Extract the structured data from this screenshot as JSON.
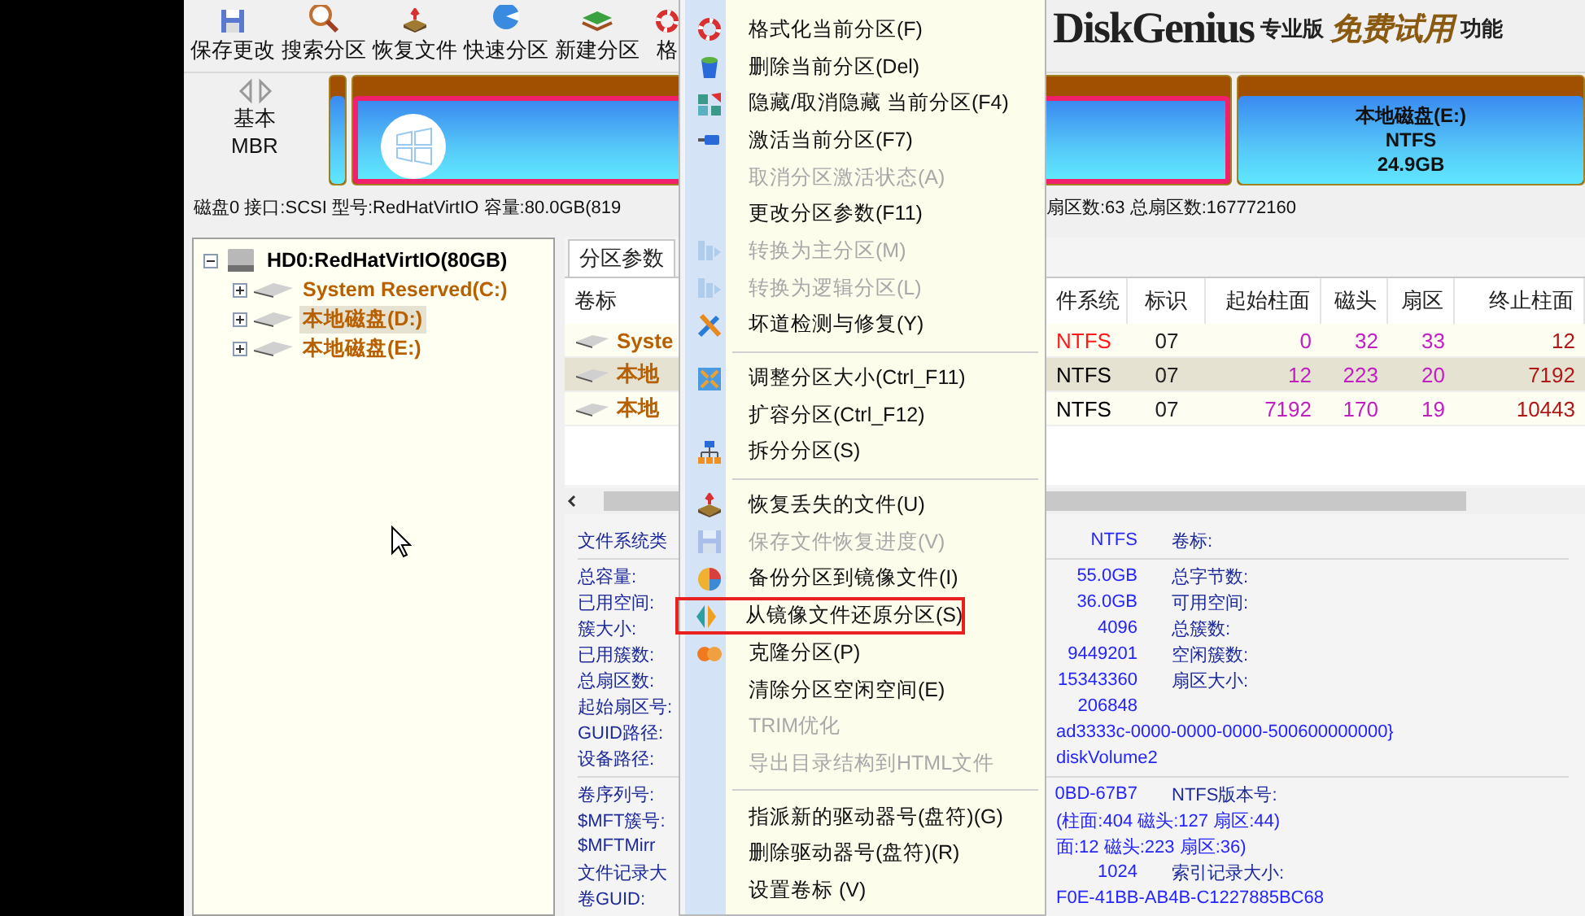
{
  "toolbar": {
    "buttons": [
      {
        "label": "保存更改"
      },
      {
        "label": "搜索分区"
      },
      {
        "label": "恢复文件"
      },
      {
        "label": "快速分区"
      },
      {
        "label": "新建分区"
      },
      {
        "label": "格"
      }
    ]
  },
  "logo": {
    "name": "DiskGenius",
    "edition": "专业版",
    "trial": "免费试用",
    "more": "功能"
  },
  "disk_map": {
    "type": "基本",
    "scheme": "MBR",
    "partitions": [
      {
        "kind": "plain",
        "selected": false
      },
      {
        "kind": "windows",
        "selected": true
      },
      {
        "kind": "labeled",
        "selected": false,
        "name": "本地磁盘(E:)",
        "fs": "NTFS",
        "size": "24.9GB"
      }
    ]
  },
  "disk_info": {
    "left": "磁盘0 接口:SCSI 型号:RedHatVirtIO 容量:80.0GB(819",
    "right": "扇区数:63 总扇区数:167772160"
  },
  "tree": {
    "label": "HD0:RedHatVirtIO(80GB)",
    "expanded": true,
    "children": [
      {
        "label": "System Reserved(C:)",
        "expanded": false,
        "selected": false
      },
      {
        "label": "本地磁盘(D:)",
        "expanded": false,
        "selected": true
      },
      {
        "label": "本地磁盘(E:)",
        "expanded": false,
        "selected": false
      }
    ]
  },
  "partition_panel": {
    "tabs": [
      {
        "label": "分区参数",
        "selected": true
      }
    ],
    "table": {
      "columns": [
        "卷标",
        "件系统",
        "标识",
        "起始柱面",
        "磁头",
        "扇区",
        "终止柱面"
      ],
      "rows": [
        {
          "selected": false,
          "color": "#ff1a1a",
          "cells": [
            "Syste",
            "NTFS",
            "07",
            "0",
            "32",
            "33",
            "12"
          ]
        },
        {
          "selected": true,
          "color": "#000000",
          "cells": [
            "本地",
            "NTFS",
            "07",
            "12",
            "223",
            "20",
            "7192"
          ]
        },
        {
          "selected": false,
          "color": "#000000",
          "cells": [
            "本地",
            "NTFS",
            "07",
            "7192",
            "170",
            "19",
            "10443"
          ]
        }
      ]
    },
    "details": [
      [
        {
          "kind": "pair",
          "label": "文件系统类",
          "value": "NTFS",
          "label2": "卷标:"
        }
      ],
      [
        {
          "kind": "pair",
          "label": "总容量:",
          "value": "55.0GB",
          "label2": "总字节数:"
        },
        {
          "kind": "pair",
          "label": "已用空间:",
          "value": "36.0GB",
          "label2": "可用空间:"
        },
        {
          "kind": "pair",
          "label": "簇大小:",
          "value": "4096",
          "label2": "总簇数:"
        },
        {
          "kind": "pair",
          "label": "已用簇数:",
          "value": "9449201",
          "label2": "空闲簇数:"
        },
        {
          "kind": "pair",
          "label": "总扇区数:",
          "value": "15343360",
          "label2": "扇区大小:"
        },
        {
          "kind": "pair",
          "label": "起始扇区号:",
          "value": "206848"
        },
        {
          "kind": "span",
          "label": "GUID路径:",
          "value": "ad3333c-0000-0000-0000-500600000000}"
        },
        {
          "kind": "span",
          "label": "设备路径:",
          "value": "diskVolume2"
        }
      ],
      [
        {
          "kind": "pair",
          "label": "卷序列号:",
          "value": "0BD-67B7",
          "label2": "NTFS版本号:"
        },
        {
          "kind": "span",
          "label": "$MFT簇号:",
          "value": "(柱面:404 磁头:127 扇区:44)"
        },
        {
          "kind": "span",
          "label": "$MFTMirr",
          "value": "面:12 磁头:223 扇区:36)"
        },
        {
          "kind": "pair",
          "label": "文件记录大",
          "value": "1024",
          "label2": "索引记录大小:"
        },
        {
          "kind": "span",
          "label": "卷GUID:",
          "value": "F0E-41BB-AB4B-C1227885BC68"
        }
      ]
    ]
  },
  "context_menu": [
    {
      "kind": "item",
      "label": "格式化当前分区(F)",
      "disabled": false,
      "highlighted": false
    },
    {
      "kind": "item",
      "label": "删除当前分区(Del)",
      "disabled": false,
      "highlighted": false
    },
    {
      "kind": "item",
      "label": "隐藏/取消隐藏 当前分区(F4)",
      "disabled": false,
      "highlighted": false
    },
    {
      "kind": "item",
      "label": "激活当前分区(F7)",
      "disabled": false,
      "highlighted": false
    },
    {
      "kind": "item",
      "label": "取消分区激活状态(A)",
      "disabled": true,
      "highlighted": false
    },
    {
      "kind": "item",
      "label": "更改分区参数(F11)",
      "disabled": false,
      "highlighted": false
    },
    {
      "kind": "item",
      "label": "转换为主分区(M)",
      "disabled": true,
      "highlighted": false
    },
    {
      "kind": "item",
      "label": "转换为逻辑分区(L)",
      "disabled": true,
      "highlighted": false
    },
    {
      "kind": "item",
      "label": "坏道检测与修复(Y)",
      "disabled": false,
      "highlighted": false
    },
    {
      "kind": "separator"
    },
    {
      "kind": "item",
      "label": "调整分区大小(Ctrl_F11)",
      "disabled": false,
      "highlighted": false
    },
    {
      "kind": "item",
      "label": "扩容分区(Ctrl_F12)",
      "disabled": false,
      "highlighted": false
    },
    {
      "kind": "item",
      "label": "拆分分区(S)",
      "disabled": false,
      "highlighted": false
    },
    {
      "kind": "separator"
    },
    {
      "kind": "item",
      "label": "恢复丢失的文件(U)",
      "disabled": false,
      "highlighted": false
    },
    {
      "kind": "item",
      "label": "保存文件恢复进度(V)",
      "disabled": true,
      "highlighted": false
    },
    {
      "kind": "item",
      "label": "备份分区到镜像文件(I)",
      "disabled": false,
      "highlighted": false
    },
    {
      "kind": "item",
      "label": "从镜像文件还原分区(S)",
      "disabled": false,
      "highlighted": true
    },
    {
      "kind": "item",
      "label": "克隆分区(P)",
      "disabled": false,
      "highlighted": false
    },
    {
      "kind": "item",
      "label": "清除分区空闲空间(E)",
      "disabled": false,
      "highlighted": false
    },
    {
      "kind": "item",
      "label": "TRIM优化",
      "disabled": true,
      "highlighted": false
    },
    {
      "kind": "item",
      "label": "导出目录结构到HTML文件",
      "disabled": true,
      "highlighted": false
    },
    {
      "kind": "separator"
    },
    {
      "kind": "item",
      "label": "指派新的驱动器号(盘符)(G)",
      "disabled": false,
      "highlighted": false
    },
    {
      "kind": "item",
      "label": "删除驱动器号(盘符)(R)",
      "disabled": false,
      "highlighted": false
    },
    {
      "kind": "item",
      "label": "设置卷标 (V)",
      "disabled": false,
      "highlighted": false
    }
  ]
}
